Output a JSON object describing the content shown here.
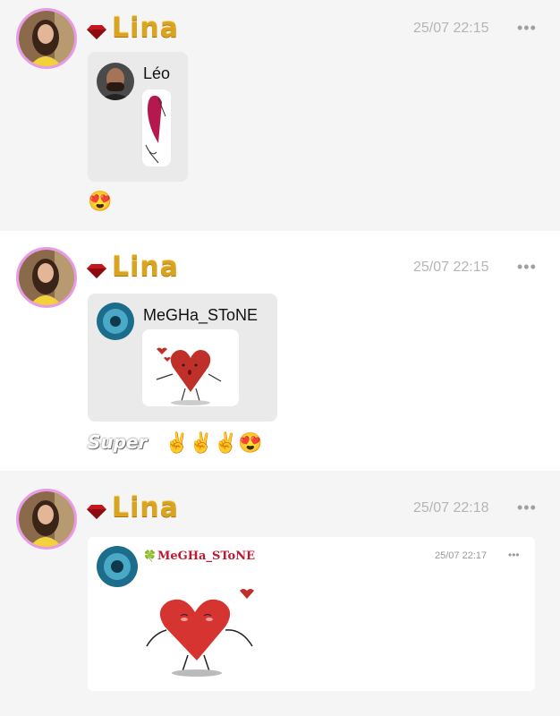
{
  "posts": [
    {
      "author": "Lina",
      "time": "25/07 22:15",
      "more": "•••",
      "quote": {
        "name": "Léo"
      },
      "reaction": "😍"
    },
    {
      "author": "Lina",
      "time": "25/07 22:15",
      "more": "•••",
      "quote": {
        "name": "MeGHa_SToNE"
      },
      "caption": "Super",
      "reaction": "✌️✌️✌️😍"
    },
    {
      "author": "Lina",
      "time": "25/07 22:18",
      "more": "•••",
      "nested": {
        "clover": "🍀",
        "name": "MeGHa_SToNE",
        "time": "25/07 22:17",
        "more": "•••"
      }
    }
  ],
  "colors": {
    "avatar_ring": "#e79ae6",
    "username_gold": "#d9a520",
    "gem_red": "#c4161c",
    "timestamp_gray": "#b5b5b5"
  }
}
